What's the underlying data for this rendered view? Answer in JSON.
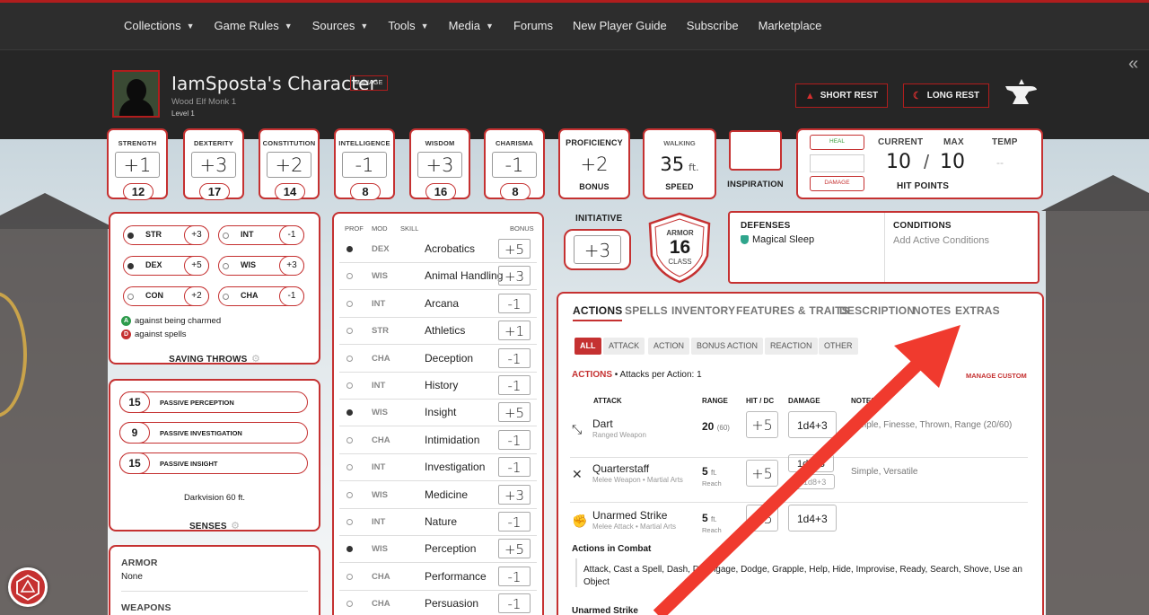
{
  "nav": {
    "items": [
      {
        "label": "Collections",
        "has_caret": true
      },
      {
        "label": "Game Rules",
        "has_caret": true
      },
      {
        "label": "Sources",
        "has_caret": true
      },
      {
        "label": "Tools",
        "has_caret": true
      },
      {
        "label": "Media",
        "has_caret": true
      },
      {
        "label": "Forums",
        "has_caret": false
      },
      {
        "label": "New Player Guide",
        "has_caret": false
      },
      {
        "label": "Subscribe",
        "has_caret": false
      },
      {
        "label": "Marketplace",
        "has_caret": false
      }
    ]
  },
  "character": {
    "name": "IamSposta's Character",
    "manage_label": "MANAGE",
    "subtitle": "Wood Elf  Monk 1",
    "level": "Level 1",
    "short_rest": "SHORT REST",
    "long_rest": "LONG REST"
  },
  "abilities": [
    {
      "label": "STRENGTH",
      "mod": "+1",
      "score": "12"
    },
    {
      "label": "DEXTERITY",
      "mod": "+3",
      "score": "17"
    },
    {
      "label": "CONSTITUTION",
      "mod": "+2",
      "score": "14"
    },
    {
      "label": "INTELLIGENCE",
      "mod": "-1",
      "score": "8"
    },
    {
      "label": "WISDOM",
      "mod": "+3",
      "score": "16"
    },
    {
      "label": "CHARISMA",
      "mod": "-1",
      "score": "8"
    }
  ],
  "proficiency": {
    "label": "PROFICIENCY",
    "value": "+2",
    "sub": "BONUS"
  },
  "speed": {
    "label": "WALKING",
    "value": "35",
    "unit": "ft.",
    "sub": "SPEED"
  },
  "inspiration": {
    "label": "INSPIRATION"
  },
  "hp": {
    "heal": "HEAL",
    "damage": "DAMAGE",
    "current_label": "CURRENT",
    "max_label": "MAX",
    "temp_label": "TEMP",
    "current": "10",
    "sep": "/",
    "max": "10",
    "temp": "--",
    "title": "HIT POINTS"
  },
  "initiative": {
    "label": "INITIATIVE",
    "value": "+3"
  },
  "armor": {
    "top": "ARMOR",
    "value": "16",
    "bottom": "CLASS"
  },
  "defenses": {
    "title": "DEFENSES",
    "item": "Magical Sleep"
  },
  "conditions": {
    "title": "CONDITIONS",
    "placeholder": "Add Active Conditions"
  },
  "saves": {
    "items": [
      {
        "name": "STR",
        "value": "+3",
        "prof": true
      },
      {
        "name": "INT",
        "value": "-1",
        "prof": false
      },
      {
        "name": "DEX",
        "value": "+5",
        "prof": true
      },
      {
        "name": "WIS",
        "value": "+3",
        "prof": false
      },
      {
        "name": "CON",
        "value": "+2",
        "prof": false
      },
      {
        "name": "CHA",
        "value": "-1",
        "prof": false
      }
    ],
    "adv_badge": "A",
    "adv_text": "against being charmed",
    "dis_badge": "D",
    "dis_text": "against spells",
    "title": "SAVING THROWS"
  },
  "senses": {
    "items": [
      {
        "value": "15",
        "label": "PASSIVE PERCEPTION"
      },
      {
        "value": "9",
        "label": "PASSIVE INVESTIGATION"
      },
      {
        "value": "15",
        "label": "PASSIVE INSIGHT"
      }
    ],
    "darkvision": "Darkvision 60 ft.",
    "title": "SENSES"
  },
  "proficiencies": {
    "armor_title": "ARMOR",
    "armor_value": "None",
    "weapons_title": "WEAPONS"
  },
  "skills": {
    "headers": {
      "prof": "PROF",
      "mod": "MOD",
      "skill": "SKILL",
      "bonus": "BONUS"
    },
    "rows": [
      {
        "prof": true,
        "mod": "DEX",
        "name": "Acrobatics",
        "bonus": "+5"
      },
      {
        "prof": false,
        "mod": "WIS",
        "name": "Animal Handling",
        "bonus": "+3"
      },
      {
        "prof": false,
        "mod": "INT",
        "name": "Arcana",
        "bonus": "-1"
      },
      {
        "prof": false,
        "mod": "STR",
        "name": "Athletics",
        "bonus": "+1"
      },
      {
        "prof": false,
        "mod": "CHA",
        "name": "Deception",
        "bonus": "-1"
      },
      {
        "prof": false,
        "mod": "INT",
        "name": "History",
        "bonus": "-1"
      },
      {
        "prof": true,
        "mod": "WIS",
        "name": "Insight",
        "bonus": "+5"
      },
      {
        "prof": false,
        "mod": "CHA",
        "name": "Intimidation",
        "bonus": "-1"
      },
      {
        "prof": false,
        "mod": "INT",
        "name": "Investigation",
        "bonus": "-1"
      },
      {
        "prof": false,
        "mod": "WIS",
        "name": "Medicine",
        "bonus": "+3"
      },
      {
        "prof": false,
        "mod": "INT",
        "name": "Nature",
        "bonus": "-1"
      },
      {
        "prof": true,
        "mod": "WIS",
        "name": "Perception",
        "bonus": "+5"
      },
      {
        "prof": false,
        "mod": "CHA",
        "name": "Performance",
        "bonus": "-1"
      },
      {
        "prof": false,
        "mod": "CHA",
        "name": "Persuasion",
        "bonus": "-1"
      }
    ]
  },
  "tabs": [
    "ACTIONS",
    "SPELLS",
    "INVENTORY",
    "FEATURES & TRAITS",
    "DESCRIPTION",
    "NOTES",
    "EXTRAS"
  ],
  "filters": [
    "ALL",
    "ATTACK",
    "ACTION",
    "BONUS ACTION",
    "REACTION",
    "OTHER"
  ],
  "actions": {
    "heading": "ACTIONS",
    "attacks_per_action": "• Attacks per Action: 1",
    "manage_custom": "MANAGE CUSTOM",
    "col_attack": "ATTACK",
    "col_range": "RANGE",
    "col_hit": "HIT / DC",
    "col_damage": "DAMAGE",
    "col_notes": "NOTES",
    "attacks": [
      {
        "name": "Dart",
        "sub": "Ranged Weapon",
        "range": "20",
        "range_extra": "(60)",
        "hit": "+5",
        "damage": "1d4+3",
        "notes": "Simple, Finesse, Thrown, Range (20/60)",
        "icon": "dart-icon"
      },
      {
        "name": "Quarterstaff",
        "sub": "Melee Weapon • Martial Arts",
        "range": "5",
        "range_extra": "ft.",
        "range_sub": "Reach",
        "hit": "+5",
        "damage": "1d6+3",
        "damage2": "1d8+3",
        "notes": "Simple, Versatile",
        "icon": "crossed-weapons-icon"
      },
      {
        "name": "Unarmed Strike",
        "sub": "Melee Attack • Martial Arts",
        "range": "5",
        "range_extra": "ft.",
        "range_sub": "Reach",
        "hit": "+5",
        "damage": "1d4+3",
        "notes": "",
        "icon": "fist-icon"
      }
    ],
    "combat_title": "Actions in Combat",
    "combat_text": "Attack, Cast a Spell, Dash, Disengage, Dodge, Grapple, Help, Hide, Improvise, Ready, Search, Shove, Use an Object",
    "next_title": "Unarmed Strike"
  },
  "colors": {
    "accent": "#c53131",
    "header_bg": "#262626",
    "nav_bg": "#2d2d2d",
    "arrow": "#f03a2e"
  }
}
